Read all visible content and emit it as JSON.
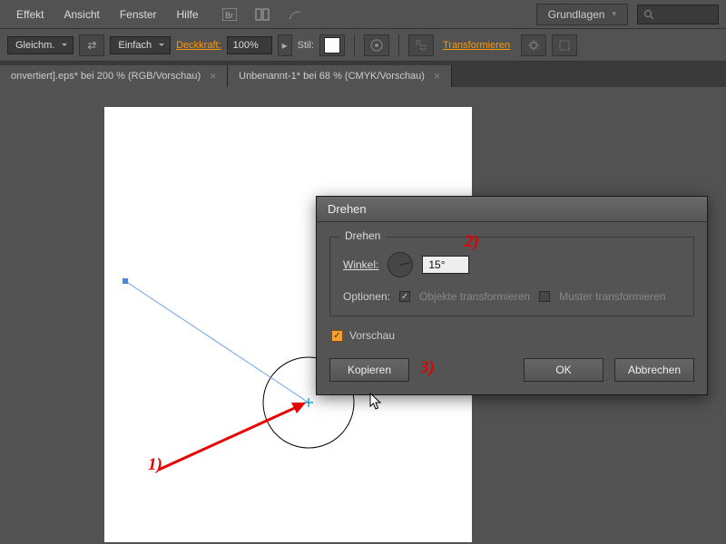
{
  "menu": {
    "items": [
      "Effekt",
      "Ansicht",
      "Fenster",
      "Hilfe"
    ]
  },
  "workspace_label": "Grundlagen",
  "optbar": {
    "stroke_align": "Gleichm.",
    "corner": "Einfach",
    "opacity_label": "Deckkraft:",
    "opacity_value": "100%",
    "style_label": "Stil:",
    "transform_label": "Transformieren"
  },
  "tabs": [
    "onvertiert].eps* bei 200 % (RGB/Vorschau)",
    "Unbenannt-1* bei 68 % (CMYK/Vorschau)"
  ],
  "dialog": {
    "title": "Drehen",
    "legend": "Drehen",
    "angle_label": "Winkel:",
    "angle_value": "15°",
    "options_label": "Optionen:",
    "opt_objects": "Objekte transformieren",
    "opt_patterns": "Muster transformieren",
    "preview_label": "Vorschau",
    "btn_copy": "Kopieren",
    "btn_ok": "OK",
    "btn_cancel": "Abbrechen"
  },
  "annotations": {
    "a1": "1)",
    "a2": "2)",
    "a3": "3)"
  }
}
